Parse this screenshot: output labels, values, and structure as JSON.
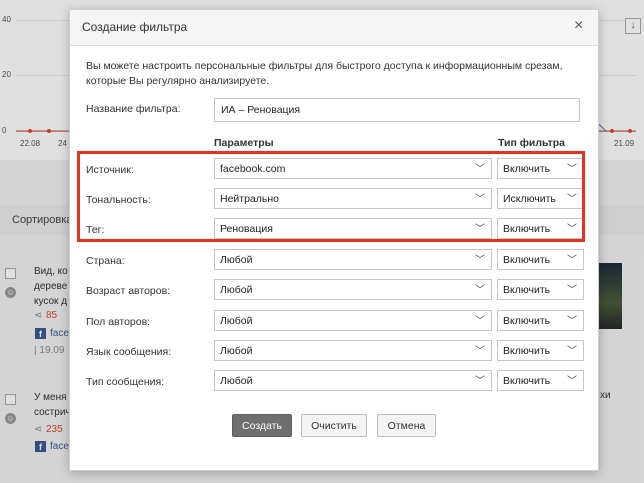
{
  "background": {
    "chart": {
      "y_ticks": [
        "40",
        "20",
        "0"
      ],
      "x_ticks": [
        "22.08",
        "24",
        "21.09"
      ]
    },
    "download_icon": "↓",
    "sort_label": "Сортировка",
    "posts": [
      {
        "lines": [
          "Вид, ко",
          "дереве",
          "кусок д"
        ],
        "shares": "85",
        "source": "face",
        "date": "| 19.09"
      },
      {
        "lines": [
          "У меня",
          "сострич"
        ],
        "shares": "235",
        "source": "face"
      }
    ],
    "side_text": "хи"
  },
  "modal": {
    "title": "Создание фильтра",
    "close_icon": "×",
    "intro": "Вы можете настроить персональные фильтры для быстрого доступа к информационным срезам, которые Вы регулярно анализируете.",
    "name_label": "Название фильтра:",
    "name_value": "ИА – Реновация",
    "col_params": "Параметры",
    "col_type": "Тип фильтра",
    "rows": [
      {
        "label": "Источник:",
        "value": "facebook.com",
        "type": "Включить"
      },
      {
        "label": "Тональность:",
        "value": "Нейтрально",
        "type": "Исключить"
      },
      {
        "label": "Тег:",
        "value": "Реновация",
        "type": "Включить"
      },
      {
        "label": "Страна:",
        "value": "Любой",
        "type": "Включить"
      },
      {
        "label": "Возраст авторов:",
        "value": "Любой",
        "type": "Включить"
      },
      {
        "label": "Пол авторов:",
        "value": "Любой",
        "type": "Включить"
      },
      {
        "label": "Язык сообщения:",
        "value": "Любой",
        "type": "Включить"
      },
      {
        "label": "Тип сообщения:",
        "value": "Любой",
        "type": "Включить"
      }
    ],
    "buttons": {
      "create": "Создать",
      "clear": "Очистить",
      "cancel": "Отмена"
    },
    "highlight_color": "#e0341f"
  }
}
